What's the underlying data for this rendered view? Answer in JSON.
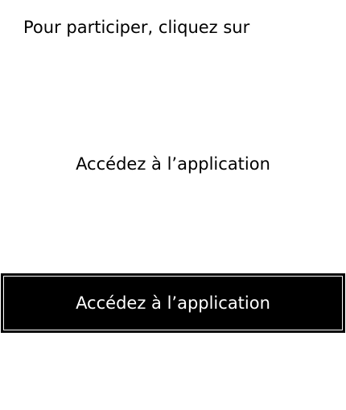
{
  "intro": {
    "text": "Pour participer, cliquez sur"
  },
  "access_link": {
    "label": "Accédez à l’application"
  },
  "access_button": {
    "label": "Accédez à l’application"
  },
  "colors": {
    "background": "#ffffff",
    "text": "#000000",
    "button_background": "#000000",
    "button_text": "#ffffff"
  }
}
